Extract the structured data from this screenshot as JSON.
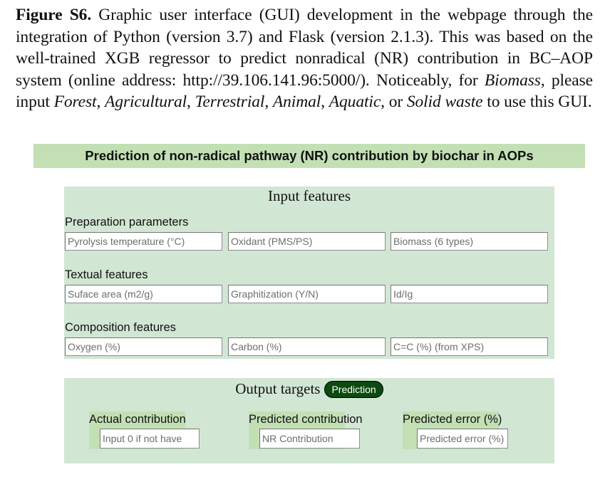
{
  "caption": {
    "figure_label": "Figure S6.",
    "text_1": " Graphic user interface (GUI) development in the webpage through the integration of Python (version 3.7) and Flask (version 2.1.3). This was based on the well-trained XGB regressor to predict nonradical (NR) contribution in BC–AOP system (online address: http://39.106.141.96:5000/). Noticeably, for ",
    "biomass_word": "Biomass",
    "text_2": ", please input ",
    "options": [
      "Forest",
      "Agricultural",
      "Terrestrial",
      "Animal",
      "Aquatic"
    ],
    "sep": ", ",
    "or_word": ", or ",
    "last_option": "Solid waste",
    "text_3": " to use this GUI."
  },
  "app": {
    "title": "Prediction of non-radical pathway (NR) contribution by biochar in AOPs",
    "colors": {
      "header_bg": "#c3e0b5",
      "panel_bg": "#d2e6d4",
      "button_bg": "#0c4a10"
    },
    "input_panel": {
      "title": "Input features",
      "groups": [
        {
          "label": "Preparation parameters",
          "fields": [
            {
              "placeholder": "Pyrolysis temperature (°C)",
              "value": ""
            },
            {
              "placeholder": "Oxidant (PMS/PS)",
              "value": ""
            },
            {
              "placeholder": "Biomass (6 types)",
              "value": ""
            }
          ]
        },
        {
          "label": "Textual features",
          "fields": [
            {
              "placeholder": "Suface area (m2/g)",
              "value": ""
            },
            {
              "placeholder": "Graphitization (Y/N)",
              "value": ""
            },
            {
              "placeholder": "Id/Ig",
              "value": ""
            }
          ]
        },
        {
          "label": "Composition features",
          "fields": [
            {
              "placeholder": "Oxygen (%)",
              "value": ""
            },
            {
              "placeholder": "Carbon (%)",
              "value": ""
            },
            {
              "placeholder": "C=C (%) (from XPS)",
              "value": ""
            }
          ]
        }
      ]
    },
    "output_panel": {
      "title": "Output targets",
      "button_label": "Prediction",
      "boxes": [
        {
          "label": "Actual contribution",
          "placeholder": "Input 0 if not have",
          "value": ""
        },
        {
          "label": "Predicted contribution",
          "placeholder": "NR Contribution",
          "value": ""
        },
        {
          "label": "Predicted error (%)",
          "placeholder": "Predicted error (%)",
          "value": ""
        }
      ]
    }
  }
}
